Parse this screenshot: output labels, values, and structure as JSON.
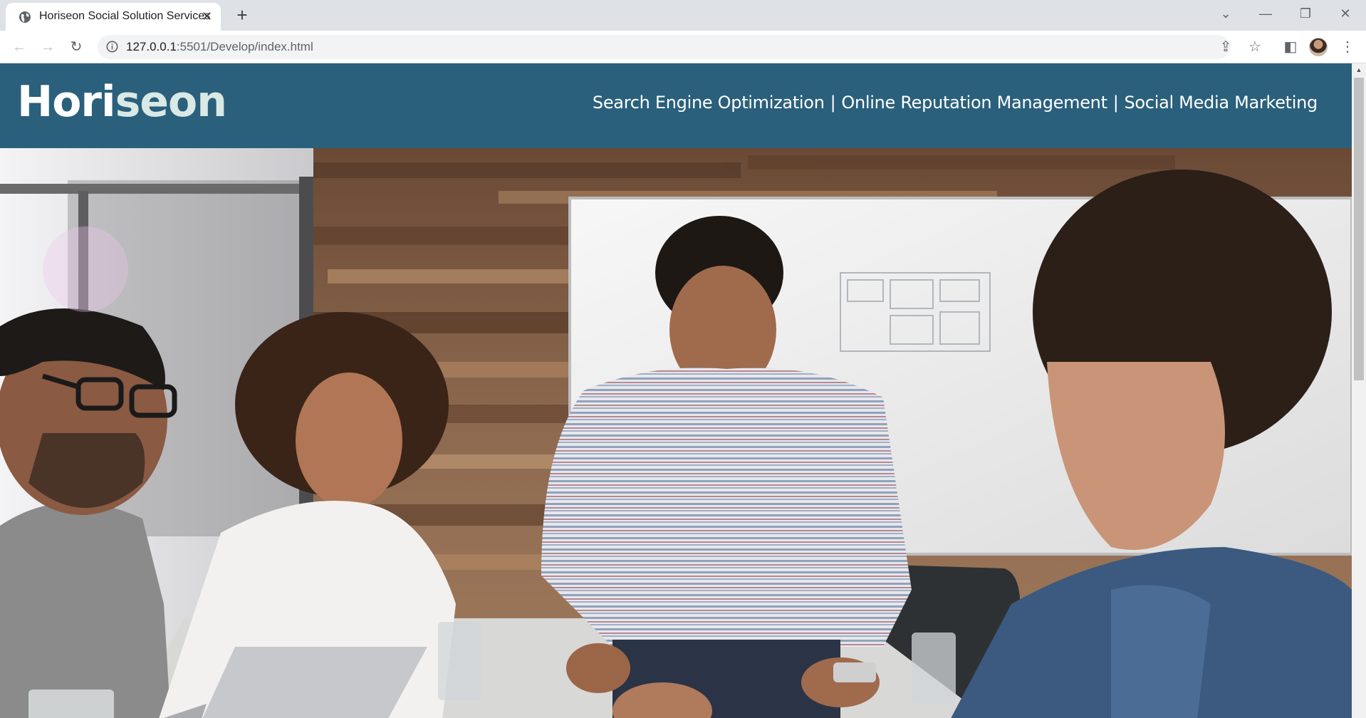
{
  "browser": {
    "tab_title": "Horiseon Social Solution Services",
    "url_host": "127.0.0.1",
    "url_rest": ":5501/Develop/index.html"
  },
  "site": {
    "logo_part1": "Hori",
    "logo_part2": "seon",
    "nav": [
      "Search Engine Optimization",
      "Online Reputation Management",
      "Social Media Marketing"
    ],
    "separator": "|"
  },
  "icons": {
    "tab_favicon": "globe-icon",
    "back": "arrow-left-icon",
    "forward": "arrow-right-icon",
    "reload": "reload-icon",
    "site_info": "info-icon",
    "share": "share-icon",
    "bookmark": "star-icon",
    "side_panel": "side-panel-icon",
    "menu": "kebab-menu-icon"
  },
  "colors": {
    "header_bg": "#2a607c",
    "logo_accent": "#d9e9e5"
  }
}
